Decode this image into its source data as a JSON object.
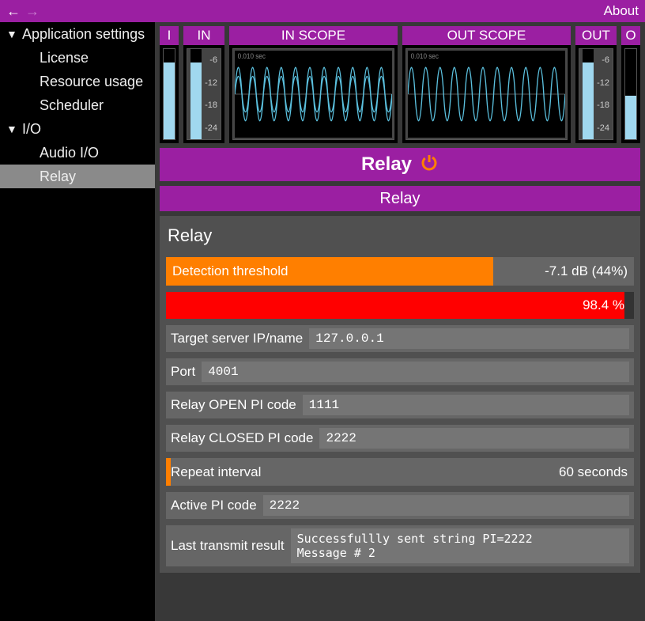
{
  "topbar": {
    "about": "About"
  },
  "sidebar": {
    "groups": [
      {
        "label": "Application settings",
        "items": [
          "License",
          "Resource usage",
          "Scheduler"
        ]
      },
      {
        "label": "I/O",
        "items": [
          "Audio I/O",
          "Relay"
        ]
      }
    ],
    "selected": "Relay"
  },
  "meters": {
    "i": {
      "label": "I",
      "level_pct": 85
    },
    "in": {
      "label": "IN",
      "scale": [
        "-6",
        "-12",
        "-18",
        "-24"
      ],
      "level_pct": 85
    },
    "in_scope": {
      "label": "IN SCOPE",
      "time_label": "0.010 sec"
    },
    "out_scope": {
      "label": "OUT SCOPE",
      "time_label": "0.010 sec"
    },
    "out": {
      "label": "OUT",
      "scale": [
        "-6",
        "-12",
        "-18",
        "-24"
      ],
      "level_pct": 85
    },
    "o": {
      "label": "O",
      "level_pct": 48
    }
  },
  "relay": {
    "big_title": "Relay",
    "section_title": "Relay",
    "panel_title": "Relay",
    "detection_threshold": {
      "label": "Detection threshold",
      "value": "-7.1 dB (44%)",
      "fill_pct": 70
    },
    "detection_level": {
      "value": "98.4 %",
      "fill_pct": 98
    },
    "target_server": {
      "label": "Target server IP/name",
      "value": "127.0.0.1"
    },
    "port": {
      "label": "Port",
      "value": "4001"
    },
    "open_pi": {
      "label": "Relay OPEN PI code",
      "value": "1111"
    },
    "closed_pi": {
      "label": "Relay CLOSED PI code",
      "value": "2222"
    },
    "repeat_interval": {
      "label": "Repeat interval",
      "value": "60 seconds"
    },
    "active_pi": {
      "label": "Active PI code",
      "value": "2222"
    },
    "last_result": {
      "label": "Last transmit result",
      "value": "Successfullly sent string PI=2222\nMessage # 2"
    }
  },
  "colors": {
    "accent": "#9b1fa2",
    "orange": "#ff7f00",
    "red": "#ff0000",
    "meter_fill": "#a0d8ef"
  }
}
